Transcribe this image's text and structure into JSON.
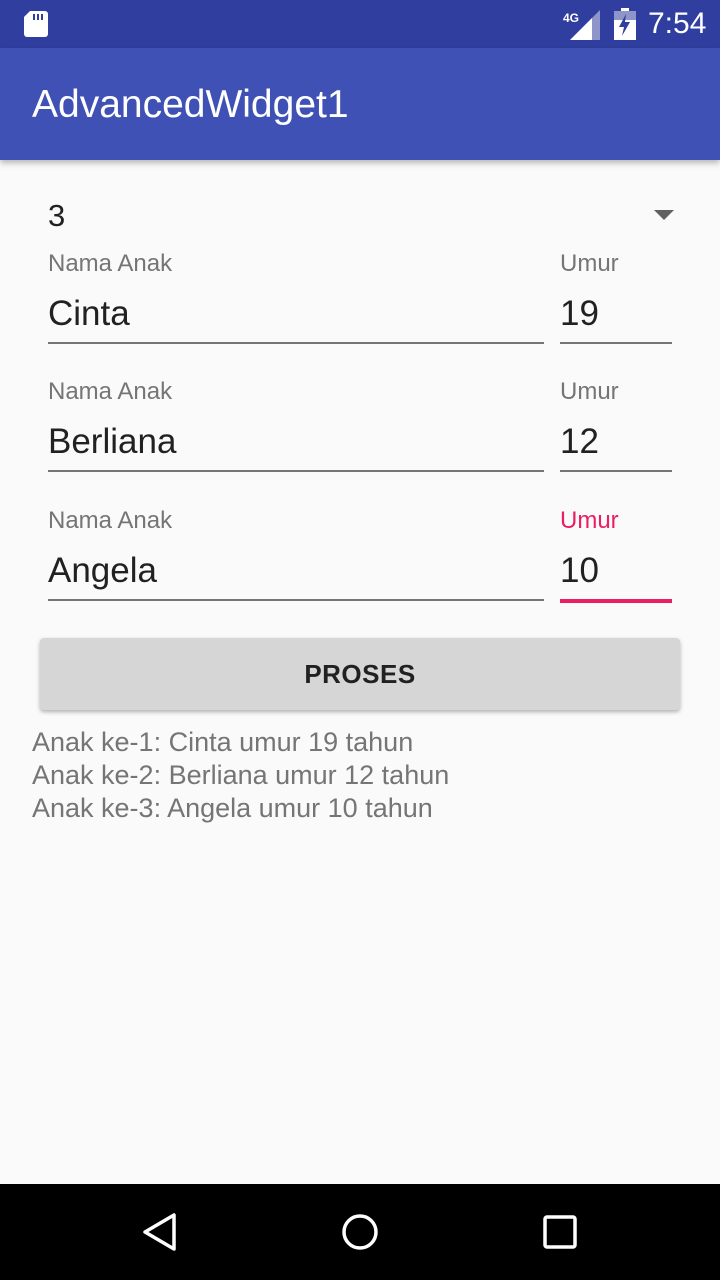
{
  "status_bar": {
    "network": "4G",
    "time": "7:54",
    "icons": [
      "sd-card-icon",
      "signal-icon",
      "battery-icon"
    ]
  },
  "app_bar": {
    "title": "AdvancedWidget1"
  },
  "spinner": {
    "selected": "3"
  },
  "children": [
    {
      "name_label": "Nama Anak",
      "name_value": "Cinta",
      "age_label": "Umur",
      "age_value": "19"
    },
    {
      "name_label": "Nama Anak",
      "name_value": "Berliana",
      "age_label": "Umur",
      "age_value": "12"
    },
    {
      "name_label": "Nama Anak",
      "name_value": "Angela",
      "age_label": "Umur",
      "age_value": "10"
    }
  ],
  "button": {
    "label": "PROSES"
  },
  "result": [
    "Anak ke-1: Cinta umur 19 tahun",
    "Anak ke-2: Berliana umur 12 tahun",
    "Anak ke-3: Angela umur 10 tahun"
  ],
  "colors": {
    "status_bar": "#303f9f",
    "app_bar": "#3f51b5",
    "accent": "#e91e63"
  },
  "nav_bar": {
    "icons": [
      "back-icon",
      "home-icon",
      "recents-icon"
    ]
  }
}
